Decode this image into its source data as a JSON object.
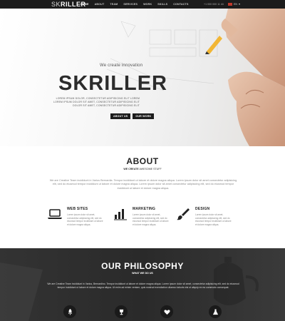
{
  "nav": {
    "logo_light": "SK",
    "logo_bold": "RILLER",
    "items": [
      "HOME",
      "ABOUT",
      "TEAM",
      "SERVICES",
      "WORK",
      "SKILLS",
      "CONTACTS"
    ],
    "active_item": "HOME",
    "phone": "+1 000 000 11 44",
    "language": "EN"
  },
  "hero": {
    "tagline": "We create innovation",
    "title": "SKRILLER",
    "text": "LOREM IPSUM DOLOR, CONSECTETUR ADIPISICING ELIT LOREM LOREM IPSUM DOLOR SIT AMET, CONSECTETUR ADIPISICING ELIT DOLOR SIT AMET, CONSECTETUR ADIPISICING ELIT",
    "button_about": "ABOUT US",
    "button_work": "OUR WORK"
  },
  "about": {
    "title": "ABOUT",
    "subtitle_bold": "WE CREATE",
    "subtitle_rest": "AWESOME STUFF",
    "description": "We are Creative Team incididunt in Varius Bernardia. Tempor incididunt ut labore et dolore magna aliqua. Lorem ipsum dolor sit amet consectetur adipisicing elit, sed do eiusmod tempor incididunt ut labore et dolore magna aliqua. Lorem ipsum dolor sit amet consectetur adipisicing elit, sed do eiusmod tempor incididunt ut labore et dolore magna aliqua.",
    "features": [
      {
        "icon": "laptop-icon",
        "title": "WEB SITES",
        "text": "Lorem ipsum dolor sit amet, consectetur adipisicing elit, sed do eiusmod tempor incididunt ut labore et dolore magna aliqua."
      },
      {
        "icon": "bar-chart-icon",
        "title": "MARKETING",
        "text": "Lorem ipsum dolor sit amet, consectetur adipisicing elit, sed do eiusmod tempor incididunt ut labore et dolore magna aliqua."
      },
      {
        "icon": "brush-icon",
        "title": "DESIGN",
        "text": "Lorem ipsum dolor sit amet, consectetur adipisicing elit, sed do eiusmod tempor incididunt ut labore et dolore magna aliqua."
      }
    ]
  },
  "philosophy": {
    "title": "OUR PHILOSOPHY",
    "subtitle": "WHAT WE DO US",
    "text": "We are Creative Team incididunt in Varius, Bernardino. Tempor incididunt ut labore et dolore magna aliqua. Lorem ipsum dolor sit amet, consectetur adipisicing elit, sed do eiusmod tempor incididunt ut labore et dolore magna aliqua. Ut enim ad minim veniam, quis nostrud exercitation ullamco laboris nisi ut aliquip ex ea commodo consequat.",
    "icons": [
      "rocket-icon",
      "trophy-icon",
      "heart-icon",
      "flask-icon"
    ]
  },
  "colors": {
    "nav_bg": "#1c1c1c",
    "dark_bg": "#2e2e2e",
    "text_dark": "#222222",
    "text_muted": "#888888"
  }
}
